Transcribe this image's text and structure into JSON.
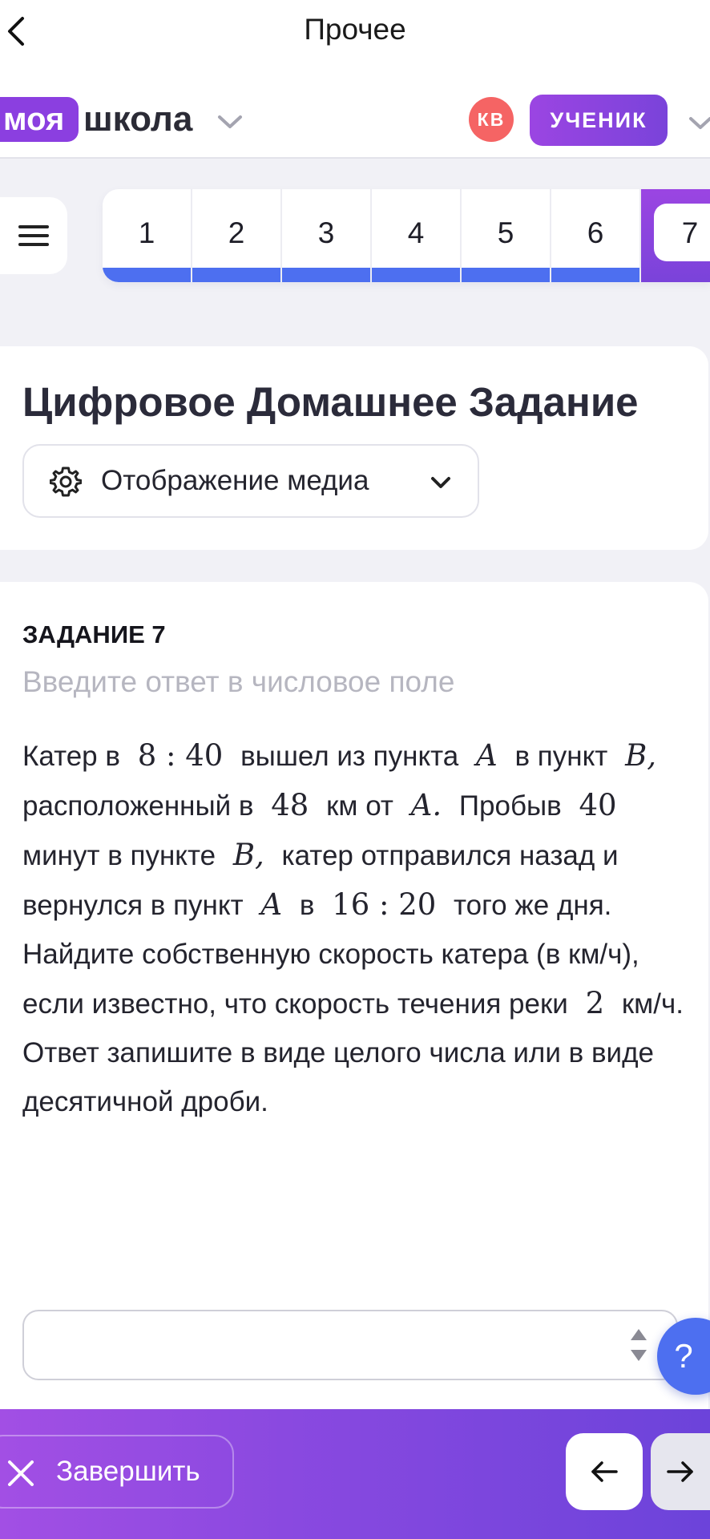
{
  "nav": {
    "title": "Прочее",
    "back_icon": "chevron-left-icon"
  },
  "header": {
    "logo_part1": "моя",
    "logo_part2": "школа",
    "avatar_initials": "КВ",
    "role": "УЧЕНИК"
  },
  "tasks": {
    "items": [
      "1",
      "2",
      "3",
      "4",
      "5",
      "6",
      "7"
    ],
    "active": "7",
    "done_color": "#4d6ff0"
  },
  "title_card": {
    "title": "Цифровое Домашнее Задание",
    "media_label": "Отображение медиа"
  },
  "task": {
    "heading": "ЗАДАНИЕ 7",
    "hint": "Введите ответ в числовое поле",
    "text": {
      "t1": "Катер в",
      "m1": "8 : 40",
      "t2": "вышел из пункта",
      "m2": "A",
      "t3": "в пункт",
      "m3": "B,",
      "t4": "расположенный в",
      "m4": "48",
      "t5": "км от",
      "m5": "A.",
      "t6": "Пробыв",
      "m6": "40",
      "t7": "минут в пункте",
      "m7": "B,",
      "t8": "катер отправился назад и вернулся в пункт",
      "m8": "A",
      "t9": "в",
      "m9": "16 : 20",
      "t10": "того же дня. Найдите собственную скорость катера (в км/ч), если известно, что скорость течения реки",
      "m10": "2",
      "t11": "км/ч.  Ответ запишите в виде целого числа или в виде десятичной дроби."
    },
    "answer_value": "",
    "help_label": "?"
  },
  "bottom": {
    "finish_label": "Завершить",
    "prev_icon": "arrow-left-icon",
    "next_icon": "arrow-right-icon"
  },
  "colors": {
    "brand_purple": "#8b3fe0",
    "accent_blue": "#4d6ff0",
    "avatar_red": "#f56464"
  }
}
